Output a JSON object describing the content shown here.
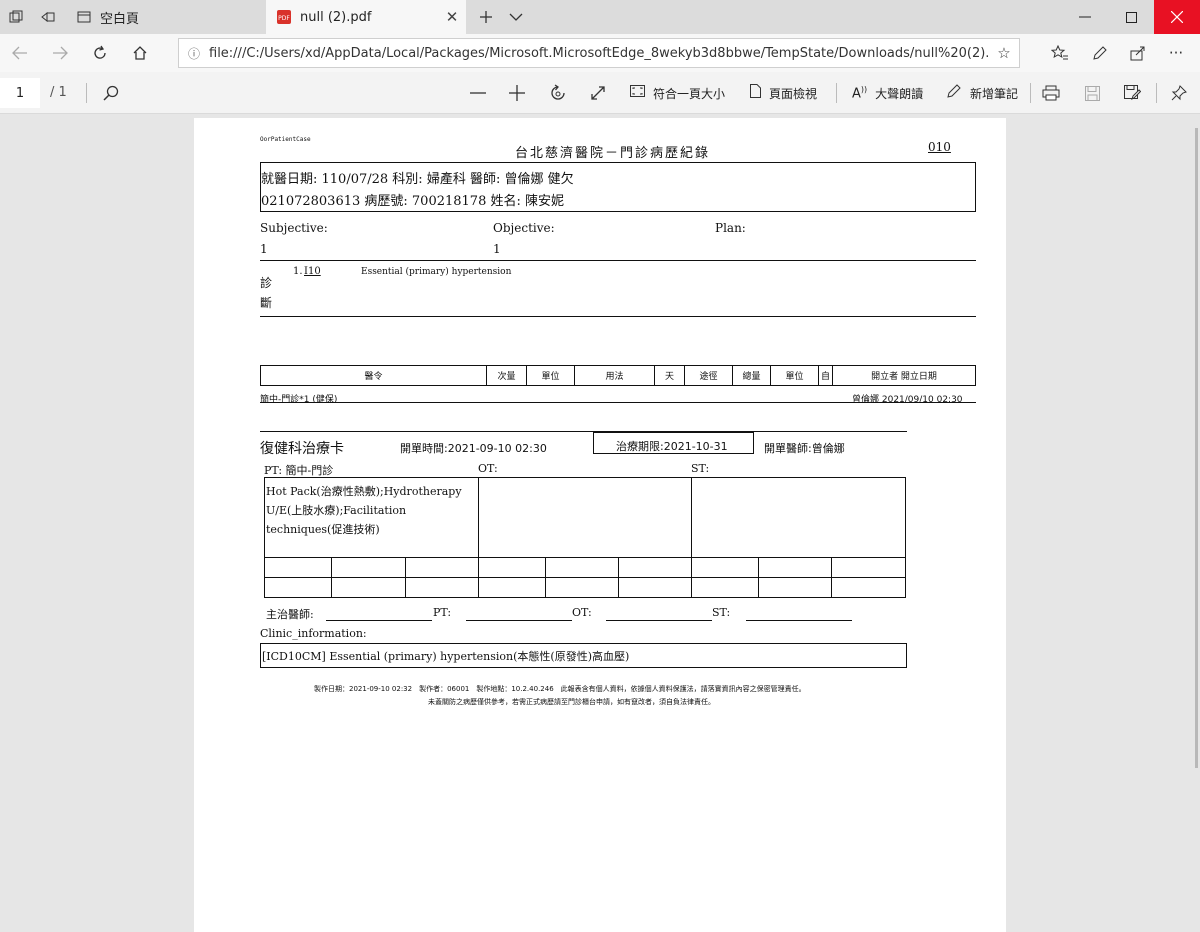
{
  "browser": {
    "tabs": [
      {
        "label": "空白頁",
        "active": false
      },
      {
        "label": "null (2).pdf",
        "active": true
      }
    ],
    "address_url": "file:///C:/Users/xd/AppData/Local/Packages/Microsoft.MicrosoftEdge_8wekyb3d8bbwe/TempState/Downloads/null%20(2).pdf"
  },
  "pdf_toolbar": {
    "page_current": "1",
    "page_total": "/ 1",
    "fit_page_label": "符合一頁大小",
    "page_view_label": "頁面檢視",
    "read_aloud_label": "大聲朗讀",
    "add_notes_label": "新增筆記"
  },
  "document": {
    "corner_code": "OorPatientCase",
    "title": "台北慈濟醫院－門診病歷紀錄",
    "page_code": "010",
    "visit_line1": "就醫日期: 110/07/28  科別: 婦產科  醫師: 曾倫娜  健欠",
    "visit_line2": "021072803613  病歷號: 700218178  姓名: 陳安妮",
    "subjective_label": "Subjective:",
    "subjective_value": "1",
    "objective_label": "Objective:",
    "objective_value": "1",
    "plan_label": "Plan:",
    "diagnosis_char1": "診",
    "diagnosis_char2": "斷",
    "diagnosis_no": "1.",
    "diagnosis_code": "I10",
    "diagnosis_desc": "Essential (primary) hypertension",
    "order_headers": [
      "醫令",
      "次量",
      "單位",
      "用法",
      "天",
      "途徑",
      "總量",
      "單位",
      "自",
      "開立者 開立日期"
    ],
    "order_row_left": "簡中-門診*1  (健保)",
    "order_row_right": "曾倫娜 2021/09/10 02:30",
    "rehab": {
      "title": "復健科治療卡",
      "order_time": "開單時間:2021-09-10 02:30",
      "deadline": "治療期限:2021-10-31",
      "doctor": "開單醫師:曾倫娜",
      "pt_label": "PT:  簡中-門診",
      "ot_label": "OT:",
      "st_label": "ST:",
      "pt_line1": "Hot Pack(治療性熱敷);Hydrotherapy",
      "pt_line2": "U/E(上肢水療);Facilitation",
      "pt_line3": "techniques(促進技術)",
      "attending_label": "主治醫師:",
      "pt_sign_label": "PT:",
      "ot_sign_label": "OT:",
      "st_sign_label": "ST:"
    },
    "clinic_info_label": "Clinic_information:",
    "clinic_info_value": "[ICD10CM] Essential (primary) hypertension(本態性(原發性)高血壓)",
    "footer_line1": "製作日期：2021-09-10 02:32　製作者：06001　製作地點：10.2.40.246　此報表含有個人資料，依據個人資料保護法，請落實資訊內容之保密管理責任。",
    "footer_line2": "未蓋關防之病歷僅供參考，若需正式病歷請至門診櫃台申請，如有竄改者，須自負法律責任。"
  }
}
